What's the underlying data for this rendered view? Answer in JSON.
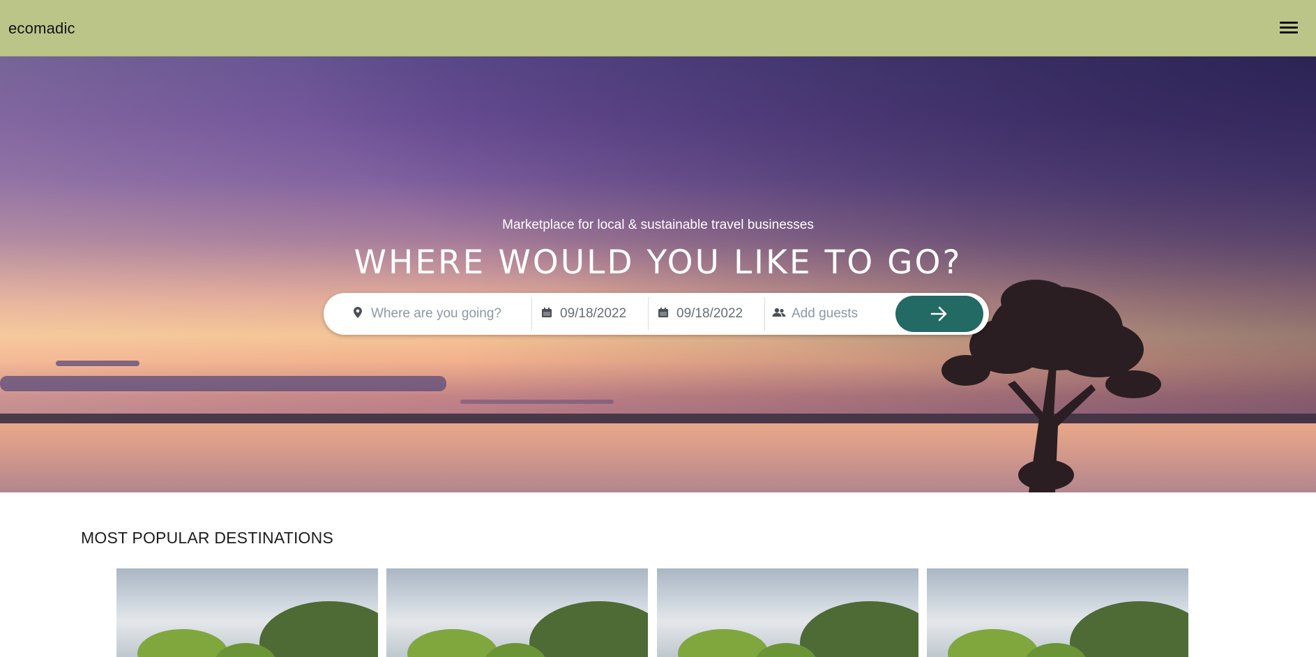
{
  "header": {
    "brand": "ecomadic",
    "menu_icon": "hamburger-menu-icon",
    "background_color": "#bcc588"
  },
  "hero": {
    "subtitle": "Marketplace for local & sustainable travel businesses",
    "title": "WHERE WOULD YOU LIKE TO GO?",
    "search": {
      "destination_placeholder": "Where are you going?",
      "destination_icon": "map-pin-icon",
      "check_in": "09/18/2022",
      "check_out": "09/18/2022",
      "calendar_icon": "calendar-icon",
      "guests_placeholder": "Add guests",
      "guests_icon": "users-icon",
      "submit_icon": "arrow-right-icon",
      "submit_color": "#236964"
    }
  },
  "popular": {
    "title": "MOST POPULAR DESTINATIONS",
    "cards": [
      {
        "image": "landscape-photo"
      },
      {
        "image": "landscape-photo"
      },
      {
        "image": "landscape-photo"
      },
      {
        "image": "landscape-photo"
      }
    ]
  }
}
